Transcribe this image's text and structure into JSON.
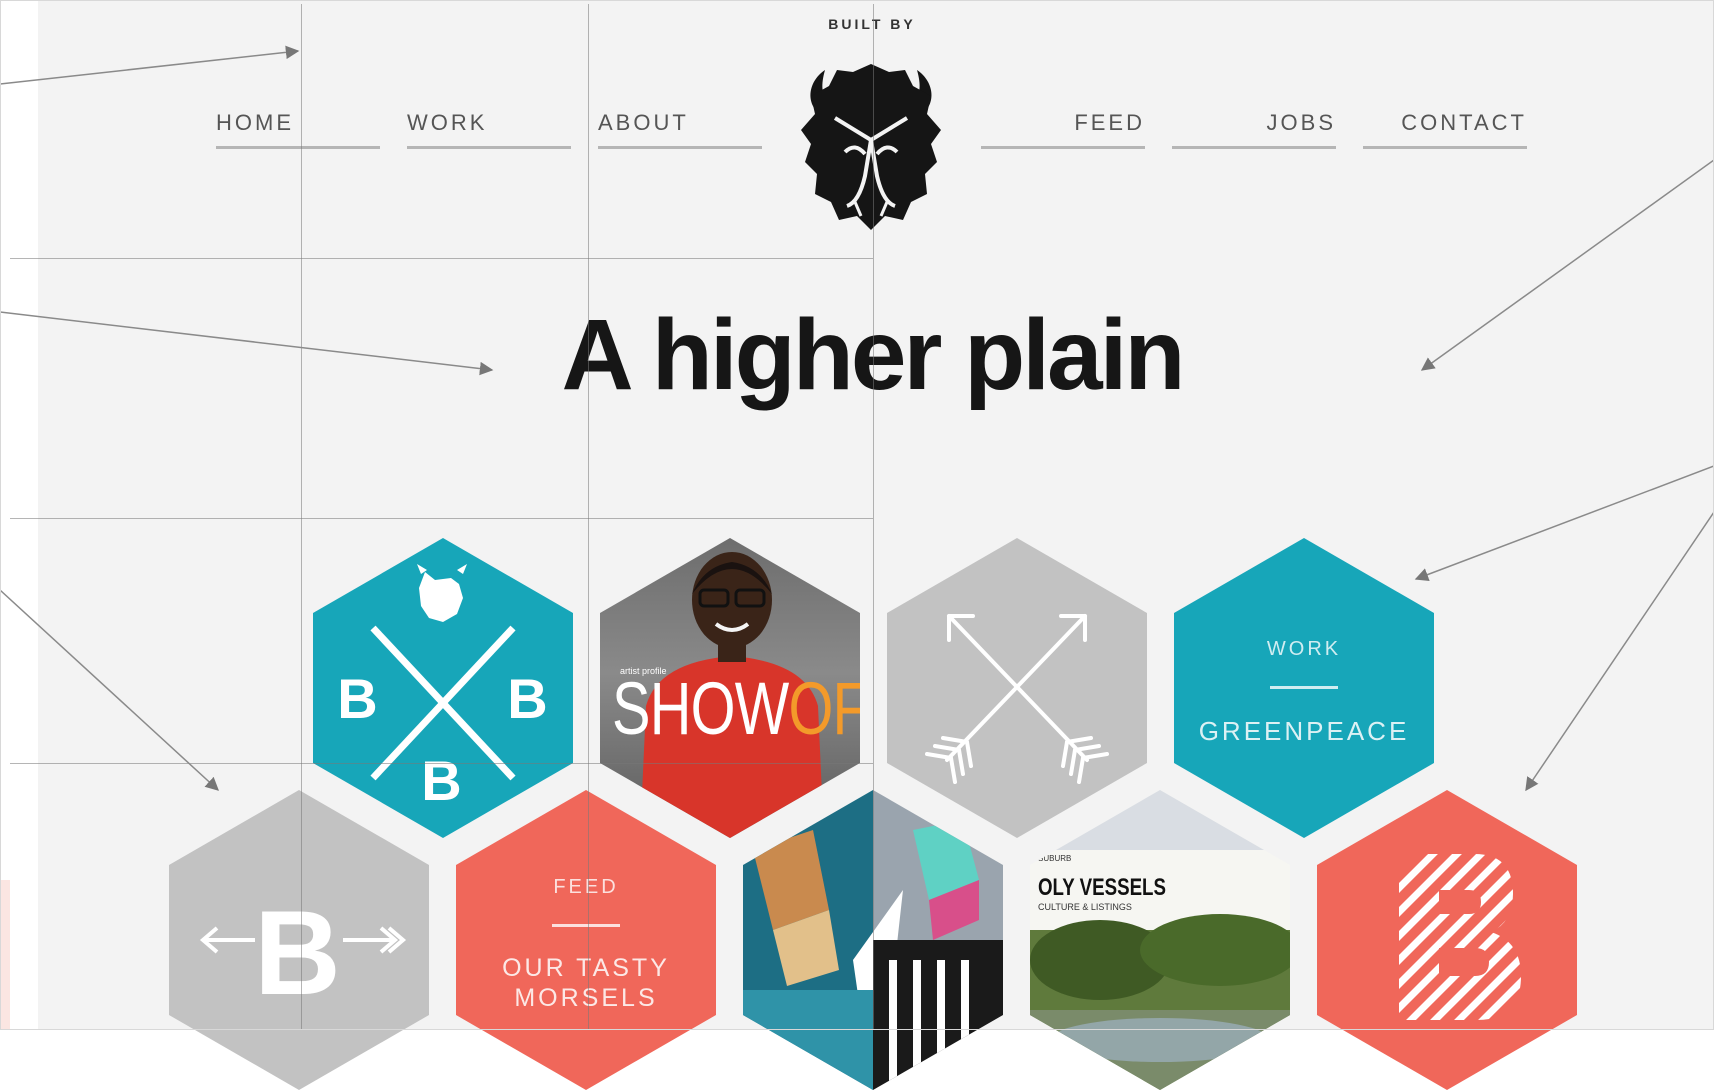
{
  "header": {
    "built_by": "BUILT BY"
  },
  "nav": {
    "left": [
      {
        "label": "HOME"
      },
      {
        "label": "WORK"
      },
      {
        "label": "ABOUT"
      }
    ],
    "right": [
      {
        "label": "FEED"
      },
      {
        "label": "JOBS"
      },
      {
        "label": "CONTACT"
      }
    ]
  },
  "logo": {
    "icon": "bison-head-icon"
  },
  "hero": {
    "title": "A higher plain"
  },
  "tiles": {
    "bbb": {
      "letters": [
        "B",
        "B",
        "B"
      ],
      "color": "#17a6b9",
      "icon": "crossed-lines-bison-icon"
    },
    "showoff": {
      "kicker": "artist profile",
      "word_a": "SHOW",
      "word_b": "OFF"
    },
    "arrows": {
      "icon": "crossed-arrows-icon",
      "color": "#c2c2c2"
    },
    "work": {
      "label": "WORK",
      "client": "GREENPEACE",
      "color": "#17a6b9"
    },
    "back": {
      "letter": "B",
      "icon": "arrow-left-icon",
      "color": "#c2c2c2"
    },
    "feed": {
      "label": "FEED",
      "tagline_1": "OUR TASTY",
      "tagline_2": "MORSELS",
      "color": "#f0675a"
    },
    "magazine": {
      "strap": "SUBURB",
      "headline": "OLY VESSELS",
      "sub": "CULTURE & LISTINGS"
    },
    "striped": {
      "letter": "B",
      "color": "#f0675a"
    }
  },
  "colors": {
    "teal": "#17a6b9",
    "coral": "#f0675a",
    "grey": "#c2c2c2",
    "ink": "#161616"
  }
}
